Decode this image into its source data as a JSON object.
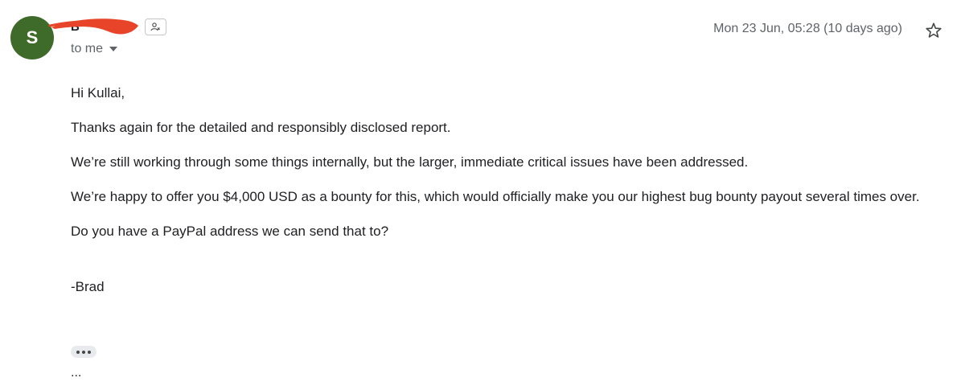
{
  "sender": {
    "avatar_letter": "S",
    "avatar_color": "#3f6b2a",
    "name": "B",
    "redaction_color": "#e8442a"
  },
  "recipient": {
    "label": "to me"
  },
  "header": {
    "timestamp": "Mon 23 Jun, 05:28 (10 days ago)"
  },
  "message": {
    "greeting": "Hi Kullai,",
    "paragraphs": [
      "Thanks again for the detailed and responsibly disclosed report.",
      "We’re still working through some things internally, but the larger, immediate critical issues have been addressed.",
      "We’re happy to offer you $4,000 USD as a bounty for this, which would officially make you our highest bug bounty payout several times over.",
      "Do you have a PayPal address we can send that to?"
    ],
    "signature": "-Brad"
  },
  "footer": {
    "ellipsis": "..."
  }
}
